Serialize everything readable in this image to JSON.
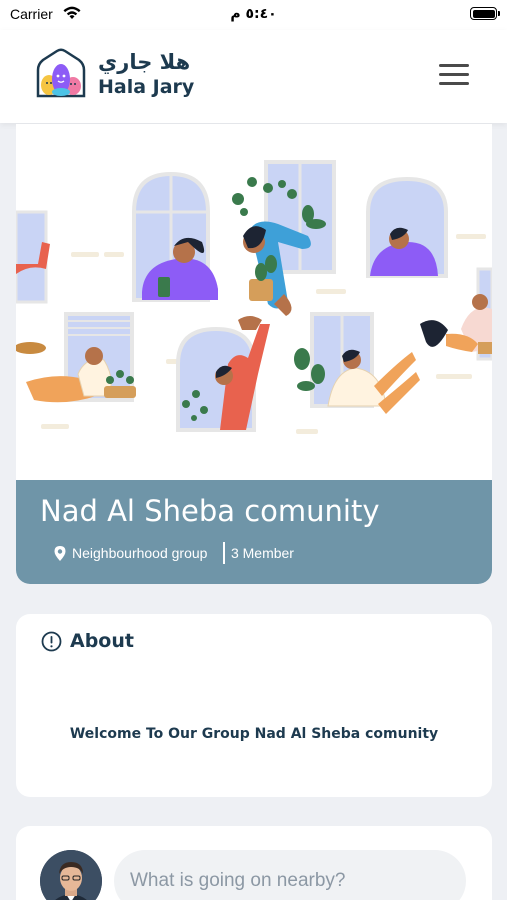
{
  "status_bar": {
    "carrier": "Carrier",
    "time": "٥:٤٠ م"
  },
  "header": {
    "logo_arabic": "هلا جاري",
    "logo_english": "Hala Jary",
    "menu_icon": "hamburger-menu-icon"
  },
  "group": {
    "name": "Nad Al Sheba comunity",
    "type": "Neighbourhood group",
    "members": "3 Member",
    "band_color": "#6f95a8"
  },
  "about": {
    "title": "About",
    "description": "Welcome To Our Group Nad Al Sheba comunity"
  },
  "composer": {
    "placeholder": "What is going on nearby?"
  }
}
